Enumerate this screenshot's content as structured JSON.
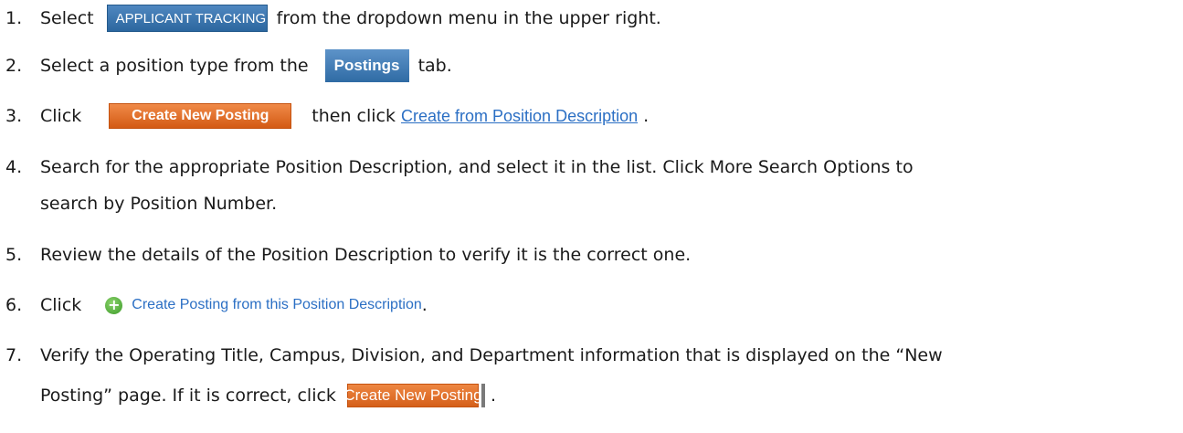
{
  "steps": [
    {
      "num": "1.",
      "pre": "Select",
      "widget": "APPLICANT TRACKING",
      "caret": "▼",
      "post": "from the dropdown menu in the upper right."
    },
    {
      "num": "2.",
      "pre": "Select a position type from the",
      "widget": "Postings",
      "post": "tab."
    },
    {
      "num": "3.",
      "pre": "Click",
      "widget": "Create New Posting",
      "mid": "then click",
      "link": "Create from Position Description",
      "post": "."
    },
    {
      "num": "4.",
      "line1": "Search for the appropriate Position Description, and select it in the list. Click More Search Options to",
      "line2": "search by Position Number."
    },
    {
      "num": "5.",
      "text": "Review the details of the Position Description to verify it is the correct one."
    },
    {
      "num": "6.",
      "pre": "Click",
      "icon": "plus-circle-icon",
      "link": "Create Posting from this Position Description",
      "post": "."
    },
    {
      "num": "7.",
      "line1": "Verify the Operating Title, Campus, Division, and Department information that is displayed on the “New",
      "line2": "Posting” page. If it is correct, click",
      "widget": "Create New Posting",
      "post": "."
    }
  ]
}
